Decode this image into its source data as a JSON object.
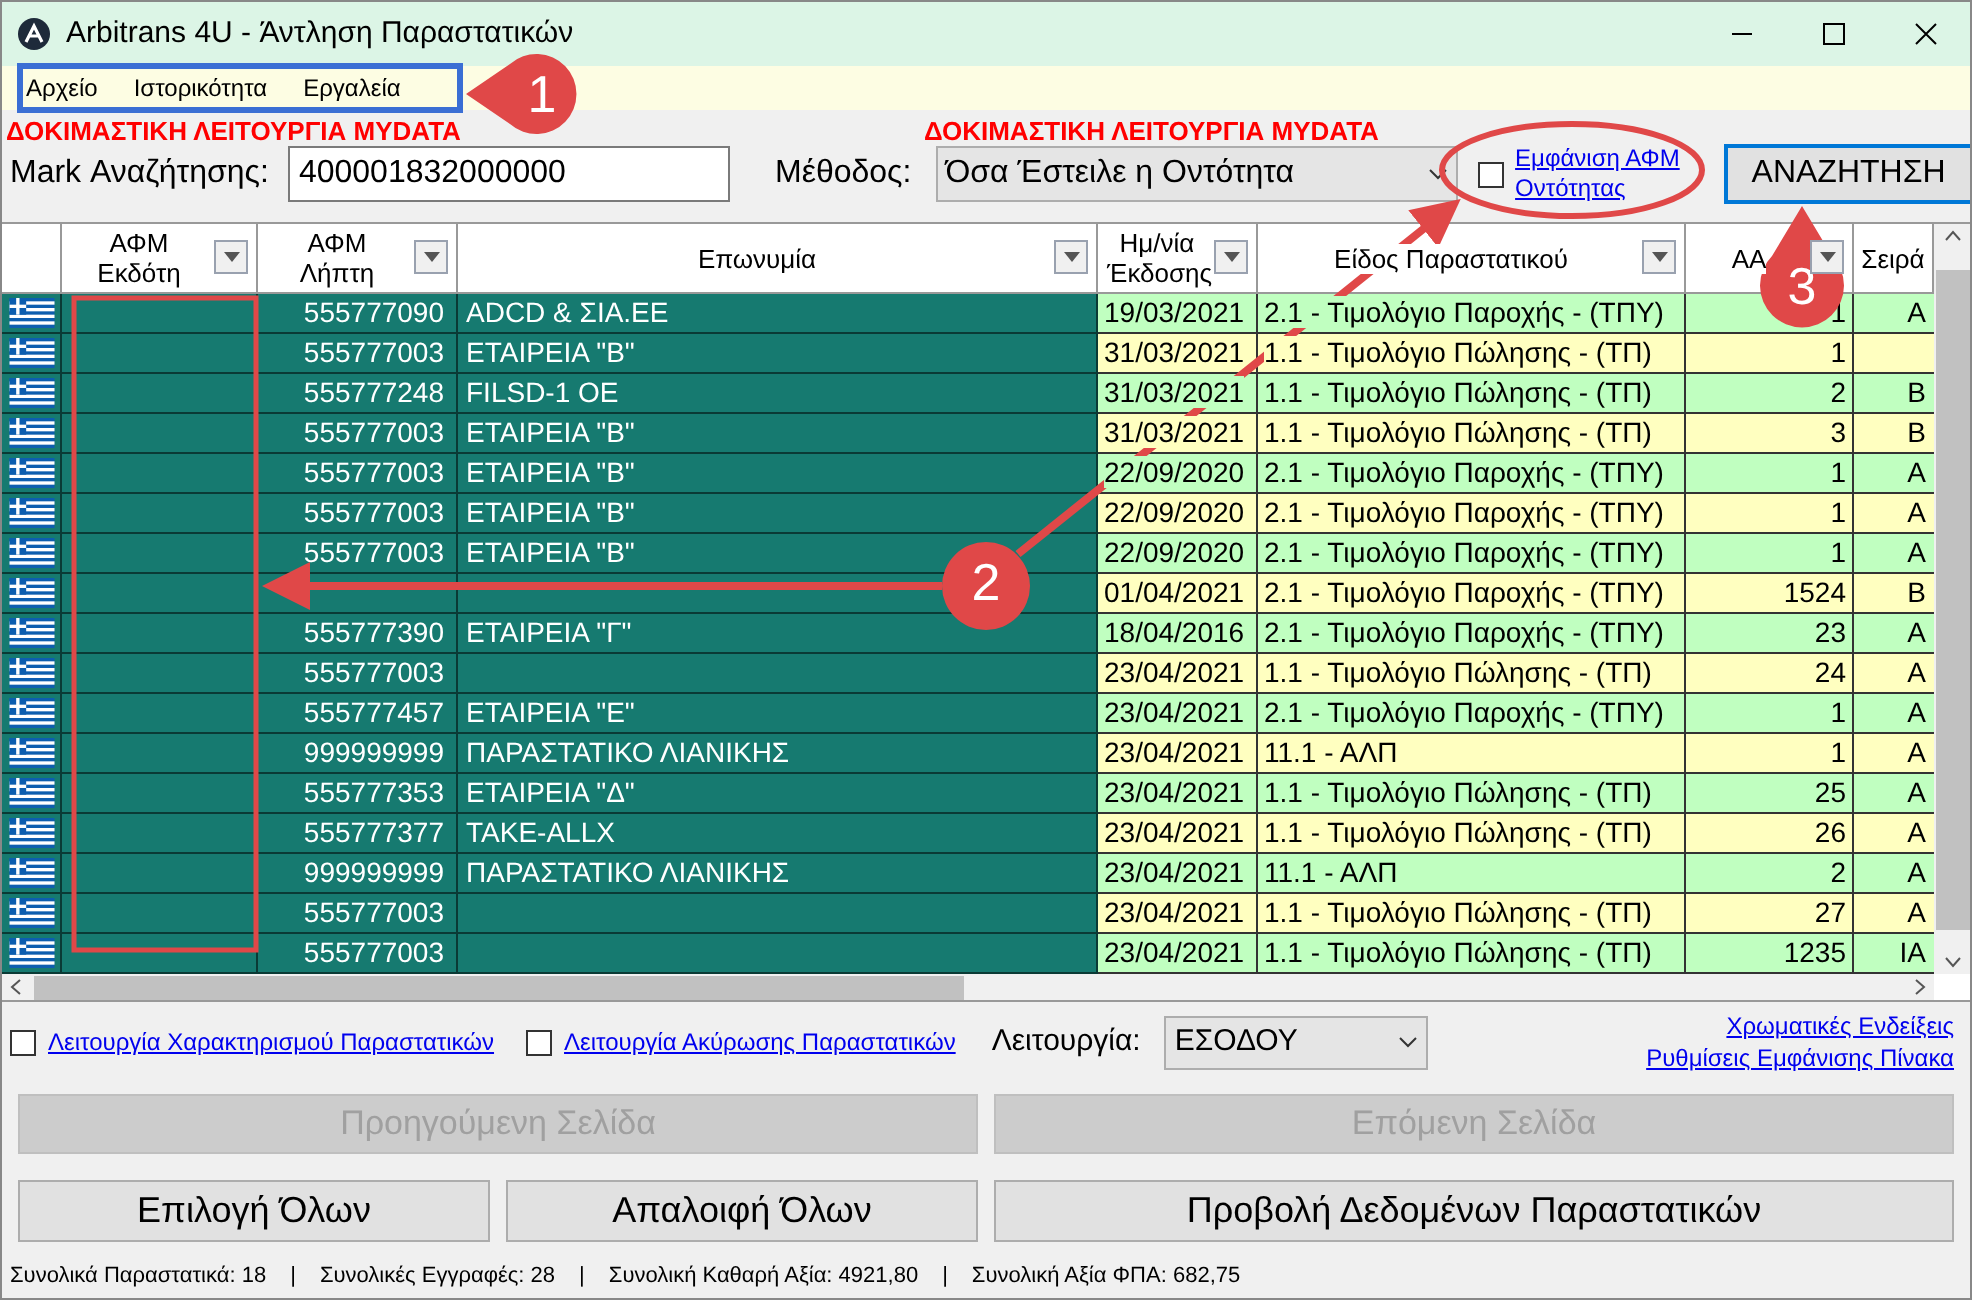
{
  "window": {
    "title": "Arbitrans 4U - Άντληση Παραστατικών"
  },
  "menu": [
    "Αρχείο",
    "Ιστορικότητα",
    "Εργαλεία"
  ],
  "test_mode_labels": [
    "ΔΟΚΙΜΑΣΤΙΚΗ ΛΕΙΤΟΥΡΓΙΑ MYDATA",
    "ΔΟΚΙΜΑΣΤΙΚΗ ΛΕΙΤΟΥΡΓΙΑ MYDATA"
  ],
  "search": {
    "label": "Mark Αναζήτησης:",
    "value": "400001832000000"
  },
  "method": {
    "label": "Μέθοδος:",
    "value": "Όσα Έστειλε η Οντότητα"
  },
  "show_vat": {
    "checked": false,
    "label": "Εμφάνιση ΑΦΜ Οντότητας"
  },
  "search_button": "ΑΝΑΖΗΤΗΣΗ",
  "table": {
    "columns": [
      {
        "label": "ΑΦΜ Εκδότη",
        "filter": true
      },
      {
        "label": "ΑΦΜ Λήπτη",
        "filter": true
      },
      {
        "label": "Επωνυμία",
        "filter": true
      },
      {
        "label": "Ημ/νία Έκδοσης",
        "filter": true
      },
      {
        "label": "Είδος Παραστατικού",
        "filter": true
      },
      {
        "label": "AA",
        "filter": true
      },
      {
        "label": "Σειρά",
        "filter": false
      }
    ],
    "rows": [
      {
        "receiver": "555777090",
        "name": "ADCD & ΣΙΑ.ΕΕ",
        "date": "19/03/2021",
        "type": "2.1 - Τιμολόγιο Παροχής - (ΤΠΥ)",
        "aa": "1",
        "series": "A",
        "color": "#c0ffc0"
      },
      {
        "receiver": "555777003",
        "name": "ΕΤΑΙΡΕΙΑ \"Β\"",
        "date": "31/03/2021",
        "type": "1.1 - Τιμολόγιο Πώλησης - (ΤΠ)",
        "aa": "1",
        "color": "#ffffc0"
      },
      {
        "receiver": "555777248",
        "name": "FILSD-1 OE",
        "date": "31/03/2021",
        "type": "1.1 - Τιμολόγιο Πώλησης - (ΤΠ)",
        "aa": "2",
        "series": "B",
        "color": "#c0ffc0"
      },
      {
        "receiver": "555777003",
        "name": "ΕΤΑΙΡΕΙΑ \"Β\"",
        "date": "31/03/2021",
        "type": "1.1 - Τιμολόγιο Πώλησης - (ΤΠ)",
        "aa": "3",
        "series": "B",
        "color": "#ffffc0"
      },
      {
        "receiver": "555777003",
        "name": "ΕΤΑΙΡΕΙΑ \"Β\"",
        "date": "22/09/2020",
        "type": "2.1 - Τιμολόγιο Παροχής - (ΤΠΥ)",
        "aa": "1",
        "series": "A",
        "color": "#c0ffc0"
      },
      {
        "receiver": "555777003",
        "name": "ΕΤΑΙΡΕΙΑ \"Β\"",
        "date": "22/09/2020",
        "type": "2.1 - Τιμολόγιο Παροχής - (ΤΠΥ)",
        "aa": "1",
        "series": "A",
        "color": "#ffffc0"
      },
      {
        "receiver": "555777003",
        "name": "ΕΤΑΙΡΕΙΑ \"Β\"",
        "date": "22/09/2020",
        "type": "2.1 - Τιμολόγιο Παροχής - (ΤΠΥ)",
        "aa": "1",
        "series": "A",
        "color": "#c0ffc0"
      },
      {
        "date": "01/04/2021",
        "type": "2.1 - Τιμολόγιο Παροχής - (ΤΠΥ)",
        "aa": "1524",
        "series": "B",
        "color": "#ffffc0"
      },
      {
        "receiver": "555777390",
        "name": "ΕΤΑΙΡΕΙΑ \"Γ\"",
        "date": "18/04/2016",
        "type": "2.1 - Τιμολόγιο Παροχής - (ΤΠΥ)",
        "aa": "23",
        "series": "A",
        "color": "#c0ffc0"
      },
      {
        "receiver": "555777003",
        "date": "23/04/2021",
        "type": "1.1 - Τιμολόγιο Πώλησης - (ΤΠ)",
        "aa": "24",
        "series": "A",
        "color": "#ffffc0"
      },
      {
        "receiver": "555777457",
        "name": "ΕΤΑΙΡΕΙΑ \"Ε\"",
        "date": "23/04/2021",
        "type": "2.1 - Τιμολόγιο Παροχής - (ΤΠΥ)",
        "aa": "1",
        "series": "A",
        "color": "#c0ffc0"
      },
      {
        "receiver": "999999999",
        "name": "ΠΑΡΑΣΤΑΤΙΚΟ ΛΙΑΝΙΚΗΣ",
        "date": "23/04/2021",
        "type": "11.1 - ΑΛΠ",
        "aa": "1",
        "series": "A",
        "color": "#ffffc0"
      },
      {
        "receiver": "555777353",
        "name": "ΕΤΑΙΡΕΙΑ \"Δ\"",
        "date": "23/04/2021",
        "type": "1.1 - Τιμολόγιο Πώλησης - (ΤΠ)",
        "aa": "25",
        "series": "A",
        "color": "#c0ffc0"
      },
      {
        "receiver": "555777377",
        "name": "TAKE-ALLX",
        "date": "23/04/2021",
        "type": "1.1 - Τιμολόγιο Πώλησης - (ΤΠ)",
        "aa": "26",
        "series": "A",
        "color": "#ffffc0"
      },
      {
        "receiver": "999999999",
        "name": "ΠΑΡΑΣΤΑΤΙΚΟ ΛΙΑΝΙΚΗΣ",
        "date": "23/04/2021",
        "type": "11.1 - ΑΛΠ",
        "aa": "2",
        "series": "A",
        "color": "#c0ffc0"
      },
      {
        "receiver": "555777003",
        "date": "23/04/2021",
        "type": "1.1 - Τιμολόγιο Πώλησης - (ΤΠ)",
        "aa": "27",
        "series": "A",
        "color": "#ffffc0"
      },
      {
        "receiver": "555777003",
        "date": "23/04/2021",
        "type": "1.1 - Τιμολόγιο Πώλησης - (ΤΠ)",
        "aa": "1235",
        "series": "IA",
        "color": "#c0ffc0"
      }
    ]
  },
  "characterization": {
    "checked": false,
    "label": "Λειτουργία Χαρακτηρισμού Παραστατικών"
  },
  "cancellation": {
    "checked": false,
    "label": "Λειτουργία Ακύρωσης Παραστατικών"
  },
  "mode": {
    "label": "Λειτουργία:",
    "value": "ΕΣΟΔΟΥ"
  },
  "links": [
    "Χρωματικές Ενδείξεις",
    "Ρυθμίσεις Εμφάνισης Πίνακα"
  ],
  "paging": [
    {
      "label": "Προηγούμενη Σελίδα",
      "disabled": true
    },
    {
      "label": "Επόμενη Σελίδα",
      "disabled": true
    }
  ],
  "actions": [
    "Επιλογή Όλων",
    "Απαλοιφή Όλων",
    "Προβολή Δεδομένων Παραστατικών"
  ],
  "status_bar": [
    {
      "label": "Συνολικά Παραστατικά:",
      "value": "18",
      "separator": "|"
    },
    {
      "label": "Συνολικές Εγγραφές:",
      "value": "28",
      "separator": "|"
    },
    {
      "label": "Συνολική Καθαρή Αξία:",
      "value": "4921,80",
      "separator": "|"
    },
    {
      "label": "Συνολική Αξία ΦΠΑ:",
      "value": "682,75"
    }
  ],
  "annotations": [
    {
      "label": "1"
    },
    {
      "label": "2"
    },
    {
      "label": "3"
    }
  ]
}
